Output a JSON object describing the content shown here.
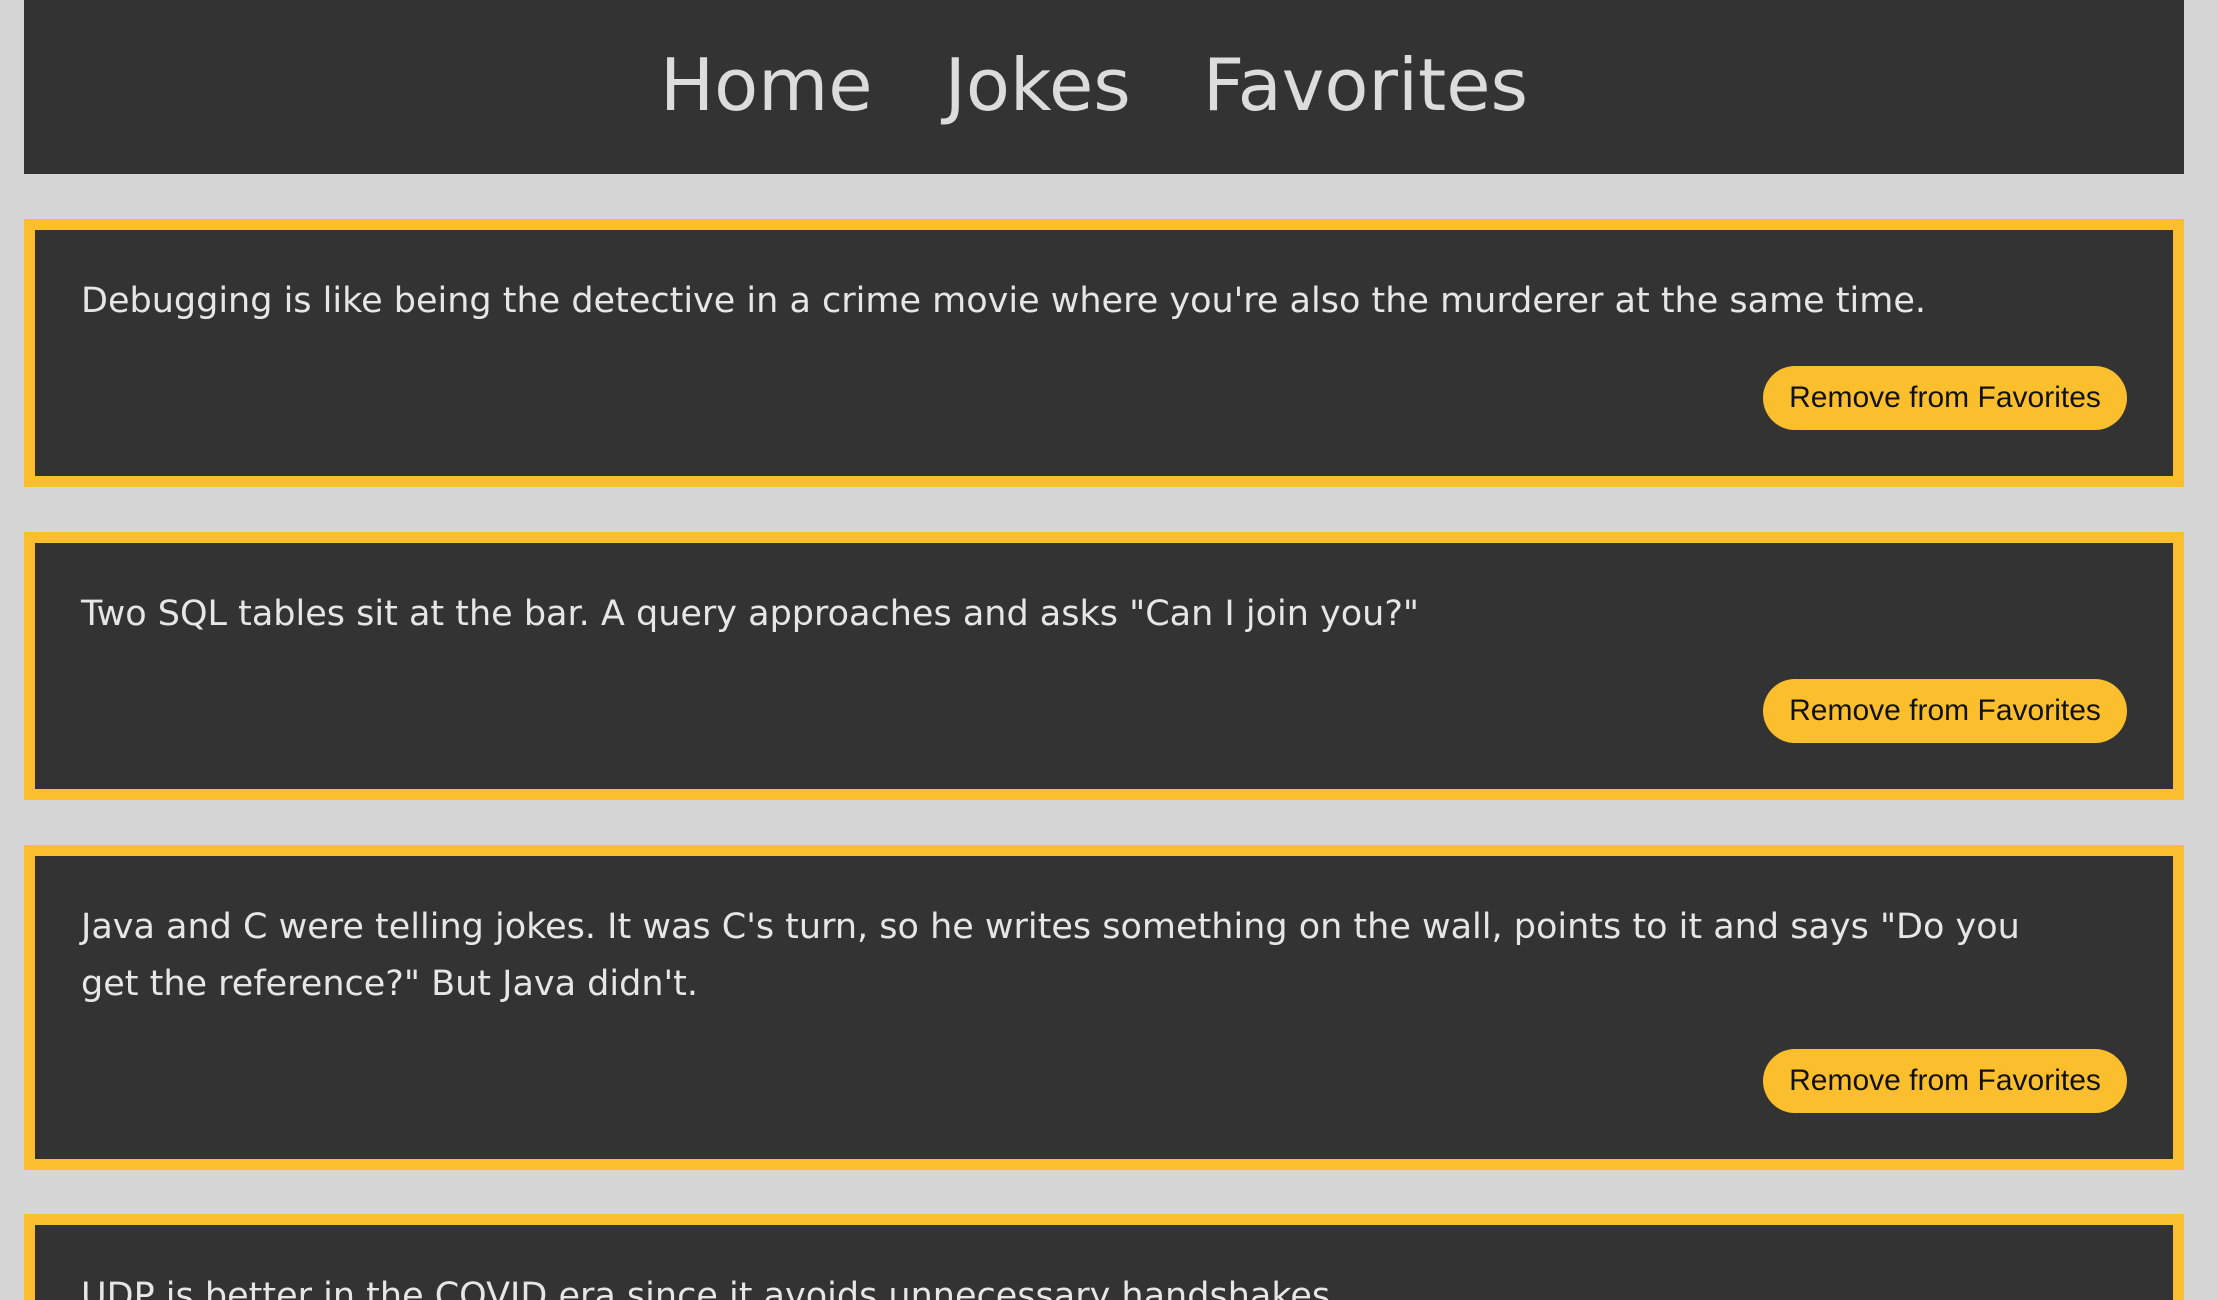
{
  "nav": {
    "home_label": "Home",
    "jokes_label": "Jokes",
    "favorites_label": "Favorites"
  },
  "favorites": [
    {
      "text": "Debugging is like being the detective in a crime movie where you're also the murderer at the same time.",
      "button_label": "Remove from Favorites"
    },
    {
      "text": "Two SQL tables sit at the bar. A query approaches and asks \"Can I join you?\"",
      "button_label": "Remove from Favorites"
    },
    {
      "text": "Java and C were telling jokes. It was C's turn, so he writes something on the wall, points to it and says \"Do you get the reference?\" But Java didn't.",
      "button_label": "Remove from Favorites"
    },
    {
      "text": "UDP is better in the COVID era since it avoids unnecessary handshakes."
    }
  ],
  "colors": {
    "background": "#d6d6d6",
    "panel": "#333333",
    "accent": "#fbbf2d",
    "text": "#e6e6e6"
  }
}
